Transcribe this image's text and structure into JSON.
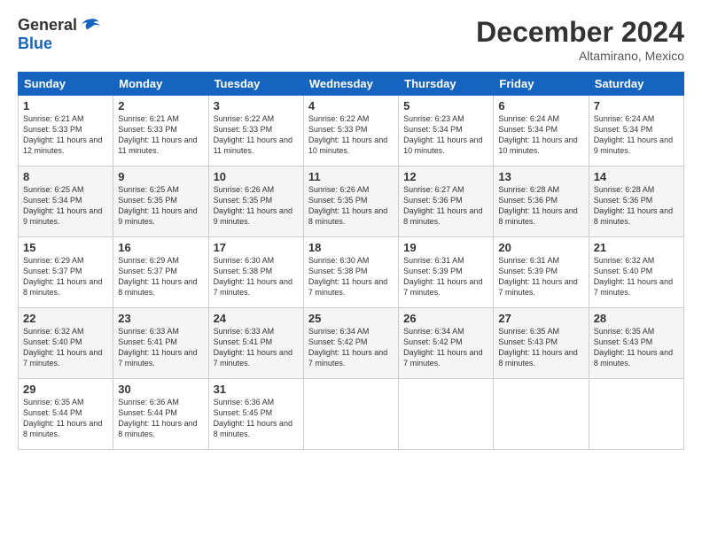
{
  "logo": {
    "general": "General",
    "blue": "Blue"
  },
  "title": "December 2024",
  "location": "Altamirano, Mexico",
  "days_of_week": [
    "Sunday",
    "Monday",
    "Tuesday",
    "Wednesday",
    "Thursday",
    "Friday",
    "Saturday"
  ],
  "weeks": [
    [
      {
        "day": "1",
        "sunrise": "6:21 AM",
        "sunset": "5:33 PM",
        "daylight": "11 hours and 12 minutes."
      },
      {
        "day": "2",
        "sunrise": "6:21 AM",
        "sunset": "5:33 PM",
        "daylight": "11 hours and 11 minutes."
      },
      {
        "day": "3",
        "sunrise": "6:22 AM",
        "sunset": "5:33 PM",
        "daylight": "11 hours and 11 minutes."
      },
      {
        "day": "4",
        "sunrise": "6:22 AM",
        "sunset": "5:33 PM",
        "daylight": "11 hours and 10 minutes."
      },
      {
        "day": "5",
        "sunrise": "6:23 AM",
        "sunset": "5:34 PM",
        "daylight": "11 hours and 10 minutes."
      },
      {
        "day": "6",
        "sunrise": "6:24 AM",
        "sunset": "5:34 PM",
        "daylight": "11 hours and 10 minutes."
      },
      {
        "day": "7",
        "sunrise": "6:24 AM",
        "sunset": "5:34 PM",
        "daylight": "11 hours and 9 minutes."
      }
    ],
    [
      {
        "day": "8",
        "sunrise": "6:25 AM",
        "sunset": "5:34 PM",
        "daylight": "11 hours and 9 minutes."
      },
      {
        "day": "9",
        "sunrise": "6:25 AM",
        "sunset": "5:35 PM",
        "daylight": "11 hours and 9 minutes."
      },
      {
        "day": "10",
        "sunrise": "6:26 AM",
        "sunset": "5:35 PM",
        "daylight": "11 hours and 9 minutes."
      },
      {
        "day": "11",
        "sunrise": "6:26 AM",
        "sunset": "5:35 PM",
        "daylight": "11 hours and 8 minutes."
      },
      {
        "day": "12",
        "sunrise": "6:27 AM",
        "sunset": "5:36 PM",
        "daylight": "11 hours and 8 minutes."
      },
      {
        "day": "13",
        "sunrise": "6:28 AM",
        "sunset": "5:36 PM",
        "daylight": "11 hours and 8 minutes."
      },
      {
        "day": "14",
        "sunrise": "6:28 AM",
        "sunset": "5:36 PM",
        "daylight": "11 hours and 8 minutes."
      }
    ],
    [
      {
        "day": "15",
        "sunrise": "6:29 AM",
        "sunset": "5:37 PM",
        "daylight": "11 hours and 8 minutes."
      },
      {
        "day": "16",
        "sunrise": "6:29 AM",
        "sunset": "5:37 PM",
        "daylight": "11 hours and 8 minutes."
      },
      {
        "day": "17",
        "sunrise": "6:30 AM",
        "sunset": "5:38 PM",
        "daylight": "11 hours and 7 minutes."
      },
      {
        "day": "18",
        "sunrise": "6:30 AM",
        "sunset": "5:38 PM",
        "daylight": "11 hours and 7 minutes."
      },
      {
        "day": "19",
        "sunrise": "6:31 AM",
        "sunset": "5:39 PM",
        "daylight": "11 hours and 7 minutes."
      },
      {
        "day": "20",
        "sunrise": "6:31 AM",
        "sunset": "5:39 PM",
        "daylight": "11 hours and 7 minutes."
      },
      {
        "day": "21",
        "sunrise": "6:32 AM",
        "sunset": "5:40 PM",
        "daylight": "11 hours and 7 minutes."
      }
    ],
    [
      {
        "day": "22",
        "sunrise": "6:32 AM",
        "sunset": "5:40 PM",
        "daylight": "11 hours and 7 minutes."
      },
      {
        "day": "23",
        "sunrise": "6:33 AM",
        "sunset": "5:41 PM",
        "daylight": "11 hours and 7 minutes."
      },
      {
        "day": "24",
        "sunrise": "6:33 AM",
        "sunset": "5:41 PM",
        "daylight": "11 hours and 7 minutes."
      },
      {
        "day": "25",
        "sunrise": "6:34 AM",
        "sunset": "5:42 PM",
        "daylight": "11 hours and 7 minutes."
      },
      {
        "day": "26",
        "sunrise": "6:34 AM",
        "sunset": "5:42 PM",
        "daylight": "11 hours and 7 minutes."
      },
      {
        "day": "27",
        "sunrise": "6:35 AM",
        "sunset": "5:43 PM",
        "daylight": "11 hours and 8 minutes."
      },
      {
        "day": "28",
        "sunrise": "6:35 AM",
        "sunset": "5:43 PM",
        "daylight": "11 hours and 8 minutes."
      }
    ],
    [
      {
        "day": "29",
        "sunrise": "6:35 AM",
        "sunset": "5:44 PM",
        "daylight": "11 hours and 8 minutes."
      },
      {
        "day": "30",
        "sunrise": "6:36 AM",
        "sunset": "5:44 PM",
        "daylight": "11 hours and 8 minutes."
      },
      {
        "day": "31",
        "sunrise": "6:36 AM",
        "sunset": "5:45 PM",
        "daylight": "11 hours and 8 minutes."
      },
      null,
      null,
      null,
      null
    ]
  ]
}
